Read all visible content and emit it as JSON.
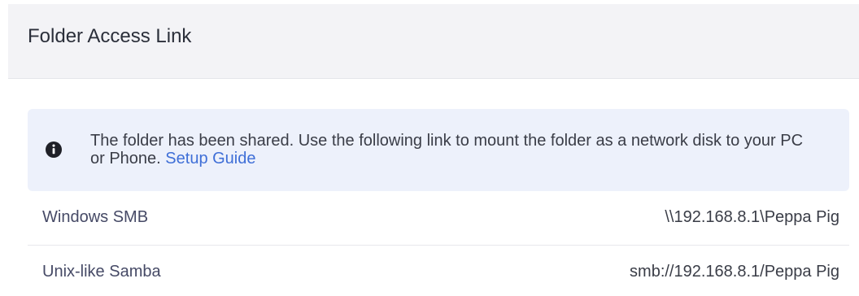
{
  "header": {
    "title": "Folder Access Link"
  },
  "alert": {
    "icon": "info-icon",
    "message": "The folder has been shared. Use the following link to mount the folder as a network disk to your PC or Phone.",
    "link_label": "Setup Guide"
  },
  "links": [
    {
      "label": "Windows SMB",
      "value": "\\\\192.168.8.1\\Peppa Pig"
    },
    {
      "label": "Unix-like Samba",
      "value": "smb://192.168.8.1/Peppa Pig"
    }
  ],
  "colors": {
    "header_bg": "#f3f3f6",
    "alert_bg": "#edf1fb",
    "link": "#3f6fd7",
    "icon": "#1f2027"
  }
}
